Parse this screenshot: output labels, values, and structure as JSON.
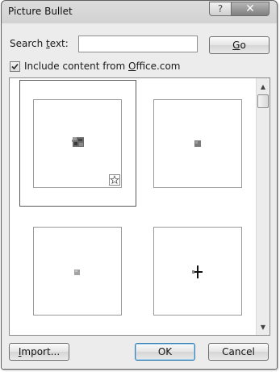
{
  "window": {
    "title": "Picture Bullet"
  },
  "titlebar": {
    "help_glyph": "?",
    "close_glyph": "✕"
  },
  "search": {
    "label_pre": "Search ",
    "label_key": "t",
    "label_post": "ext:",
    "value": "",
    "placeholder": ""
  },
  "go_button": {
    "key": "G",
    "rest": "o"
  },
  "include_option": {
    "checked": true,
    "label_pre": "Include content from ",
    "label_key": "O",
    "label_post": "ffice.com"
  },
  "gallery": {
    "items": [
      {
        "name": "gray-marble-bullet",
        "selected": true,
        "badge": "office-com-star-icon"
      },
      {
        "name": "small-gray-square-bullet",
        "selected": false
      },
      {
        "name": "small-light-gray-square-bullet",
        "selected": false
      },
      {
        "name": "black-cross-bullet",
        "selected": false
      }
    ]
  },
  "footer": {
    "import_key": "I",
    "import_rest": "mport...",
    "ok_label": "OK",
    "cancel_label": "Cancel"
  },
  "colors": {
    "ok_border": "#3c7fb1",
    "tile_border": "#9a9a9a"
  }
}
